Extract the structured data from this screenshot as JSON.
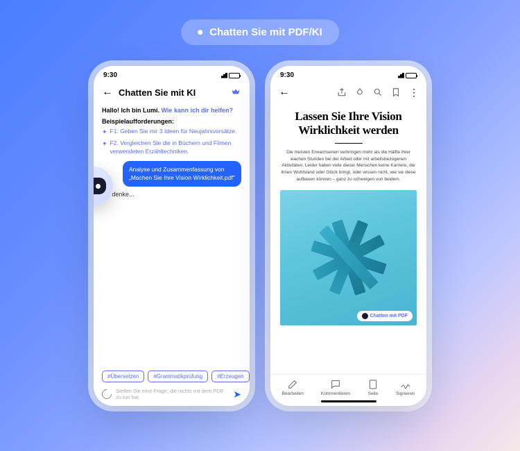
{
  "pill_label": "Chatten Sie mit PDF/KI",
  "status_time": "9:30",
  "phone1": {
    "header_title": "Chatten Sie mit KI",
    "greeting_hello": "Hallo! Ich bin Lumi.",
    "greeting_question": "Wie kann ich dir helfen?",
    "prompts_label": "Beispielaufforderungen:",
    "prompts": [
      "F1. Geben Sie mir 3 Ideen für Neujahrsvorsätze.",
      "F2. Vergleichen Sie die in Büchern und Filmen verwendeten Erzähltechniken."
    ],
    "user_message": "Analyse und Zusammenfassung von „Machen Sie Ihre Vision Wirklichkeit.pdf\"",
    "thinking": "Ich denke...",
    "chips": [
      "#Übersetzen",
      "#Grammatikprüfung",
      "#Erzeugen"
    ],
    "input_placeholder": "Stellen Sie eine Frage, die nichts mit dem PDF zu tun hat."
  },
  "phone2": {
    "doc_title": "Lassen Sie Ihre Vision Wirklichkeit werden",
    "doc_text": "Die meisten Erwachsenen verbringen mehr als die Hälfte ihrer wachen Stunden bei der Arbeit oder mit arbeitsbezogenen Aktivitäten. Leider haben viele dieser Menschen keine Karriere, die ihnen Wohlstand oder Glück bringt, oder wissen nicht, wie sie diese aufbauen können – ganz zu schweigen von beidem.",
    "chat_pdf_label": "Chatten mit PDF",
    "nav": [
      "Bearbeiten",
      "Kommentieren",
      "Seite",
      "Signieren"
    ]
  }
}
